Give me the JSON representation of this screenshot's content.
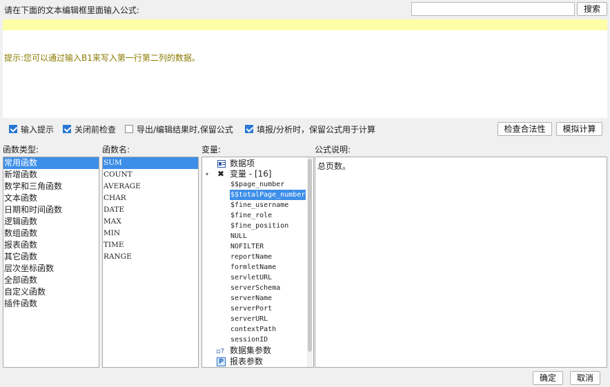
{
  "header": {
    "prompt": "请在下面的文本编辑框里面输入公式:",
    "search_label": "搜索",
    "search_value": ""
  },
  "editor": {
    "value": "",
    "hint": "提示:您可以通过输入B1来写入第一行第二列的数据。"
  },
  "options": [
    {
      "label": "输入提示",
      "checked": true
    },
    {
      "label": "关闭前检查",
      "checked": true
    },
    {
      "label": "导出/编辑结果时,保留公式",
      "checked": false
    },
    {
      "label": "填报/分析时，保留公式用于计算",
      "checked": true
    }
  ],
  "actions": {
    "check": "检查合法性",
    "simulate": "模拟计算"
  },
  "columns": {
    "types": "函数类型:",
    "names": "函数名:",
    "vars": "变量:",
    "desc": "公式说明:"
  },
  "function_types": [
    "常用函数",
    "新增函数",
    "数学和三角函数",
    "文本函数",
    "日期和时间函数",
    "逻辑函数",
    "数组函数",
    "报表函数",
    "其它函数",
    "层次坐标函数",
    "全部函数",
    "自定义函数",
    "插件函数"
  ],
  "function_names": [
    "SUM",
    "COUNT",
    "AVERAGE",
    "CHAR",
    "DATE",
    "MAX",
    "MIN",
    "TIME",
    "RANGE"
  ],
  "tree": {
    "data_items": "数据项",
    "variables_label": "变量 - [16]",
    "variables": [
      "$$page_number",
      "$$totalPage_number",
      "$fine_username",
      "$fine_role",
      "$fine_position",
      "NULL",
      "NOFILTER",
      "reportName",
      "formletName",
      "servletURL",
      "serverSchema",
      "serverName",
      "serverPort",
      "serverURL",
      "contextPath",
      "sessionID"
    ],
    "dataset_params": "数据集参数",
    "report_params": "报表参数"
  },
  "description": "总页数。",
  "footer": {
    "ok": "确定",
    "cancel": "取消"
  }
}
